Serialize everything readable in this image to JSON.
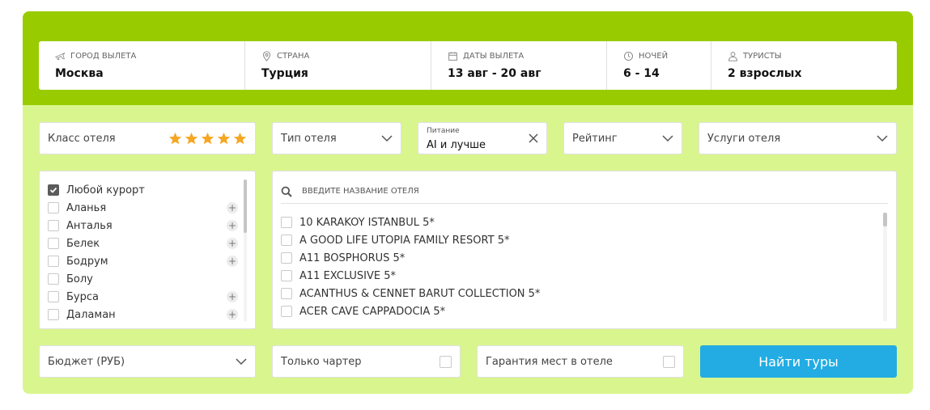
{
  "params": [
    {
      "label": "ГОРОД ВЫЛЕТА",
      "value": "Москва",
      "icon": "plane-icon"
    },
    {
      "label": "СТРАНА",
      "value": "Турция",
      "icon": "map-pin-icon"
    },
    {
      "label": "ДАТЫ ВЫЛЕТА",
      "value": "13 авг - 20 авг",
      "icon": "calendar-icon"
    },
    {
      "label": "НОЧЕЙ",
      "value": "6 - 14",
      "icon": "clock-icon"
    },
    {
      "label": "ТУРИСТЫ",
      "value": "2 взрослых",
      "icon": "user-icon"
    }
  ],
  "filters": {
    "hotel_class": {
      "label": "Класс отеля",
      "stars_selected": 5,
      "star_color": "#f5a623"
    },
    "hotel_type": {
      "label": "Тип отеля"
    },
    "food": {
      "label": "Питание",
      "value": "AI и лучше"
    },
    "rating": {
      "label": "Рейтинг"
    },
    "services": {
      "label": "Услуги отеля"
    }
  },
  "resorts": [
    {
      "name": "Любой курорт",
      "checked": true,
      "expandable": false
    },
    {
      "name": "Аланья",
      "checked": false,
      "expandable": true
    },
    {
      "name": "Анталья",
      "checked": false,
      "expandable": true
    },
    {
      "name": "Белек",
      "checked": false,
      "expandable": true
    },
    {
      "name": "Бодрум",
      "checked": false,
      "expandable": true
    },
    {
      "name": "Болу",
      "checked": false,
      "expandable": false
    },
    {
      "name": "Бурса",
      "checked": false,
      "expandable": true
    },
    {
      "name": "Даламан",
      "checked": false,
      "expandable": true
    }
  ],
  "hotel_search": {
    "placeholder": "ВВЕДИТЕ НАЗВАНИЕ ОТЕЛЯ"
  },
  "hotels": [
    "10 KARAKOY ISTANBUL 5*",
    "A GOOD LIFE UTOPIA FAMILY RESORT 5*",
    "A11 BOSPHORUS 5*",
    "A11 EXCLUSIVE 5*",
    "ACANTHUS & CENNET BARUT COLLECTION 5*",
    "ACER CAVE CAPPADOCIA 5*"
  ],
  "bottom": {
    "budget_label": "Бюджет (РУБ)",
    "charter_label": "Только чартер",
    "guarantee_label": "Гарантия мест в отеле",
    "search_button": "Найти туры"
  },
  "colors": {
    "header_green": "#99cc00",
    "panel_green": "#d9f68e",
    "button_blue": "#22ace3",
    "star": "#f5a623"
  }
}
